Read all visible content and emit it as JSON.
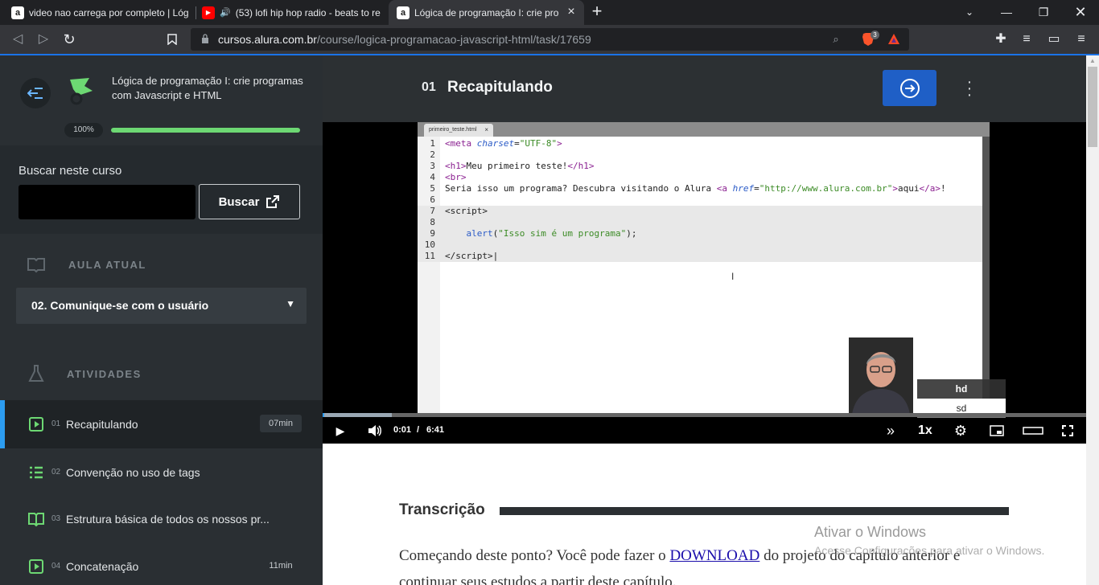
{
  "browser": {
    "tabs": [
      {
        "title": "video nao carrega por completo | Lóg",
        "favicon": "a"
      },
      {
        "title": "(53) lofi hip hop radio - beats to re",
        "favicon": "▶"
      },
      {
        "title": "Lógica de programação I: crie pro",
        "favicon": "a"
      }
    ],
    "url_host": "cursos.alura.com.br",
    "url_path": "/course/logica-programacao-javascript-html/task/17659",
    "brave_badge": "3"
  },
  "sidebar": {
    "course_title": "Lógica de programação I: crie programas com Javascript e HTML",
    "progress_label": "100%",
    "progress_fraction": 1.0,
    "search_label": "Buscar neste curso",
    "search_value": "",
    "search_button": "Buscar",
    "current_section_label": "AULA ATUAL",
    "current_lesson": "02. Comunique-se com o usuário",
    "activities_label": "ATIVIDADES",
    "activities": [
      {
        "num": "01",
        "label": "Recapitulando",
        "duration": "07min",
        "icon": "video-icon"
      },
      {
        "num": "02",
        "label": "Convenção no uso de tags",
        "duration": "",
        "icon": "list-icon"
      },
      {
        "num": "03",
        "label": "Estrutura básica de todos os nossos pr...",
        "duration": "",
        "icon": "book-icon"
      },
      {
        "num": "04",
        "label": "Concatenação",
        "duration": "11min",
        "icon": "video-icon"
      }
    ]
  },
  "main": {
    "task_num": "01",
    "task_title": "Recapitulando"
  },
  "video": {
    "editor_tab": "primeiro_teste.html",
    "code": [
      {
        "n": "1"
      },
      {
        "n": "2"
      },
      {
        "n": "3"
      },
      {
        "n": "4"
      },
      {
        "n": "5"
      },
      {
        "n": "6"
      },
      {
        "n": "7"
      },
      {
        "n": "8"
      },
      {
        "n": "9"
      },
      {
        "n": "10"
      },
      {
        "n": "11"
      }
    ],
    "current_time": "0:01",
    "separator": "/",
    "duration": "6:41",
    "speed": "1x",
    "quality_options": [
      "hd",
      "sd"
    ],
    "played_fraction": 0.002
  },
  "transcript": {
    "heading": "Transcrição",
    "text_before": "Começando deste ponto? Você pode fazer o ",
    "link": "DOWNLOAD",
    "text_after": " do projeto do capítulo anterior e continuar seus estudos a partir deste capítulo."
  },
  "watermark": {
    "line1": "Ativar o Windows",
    "line2": "Acesse Configurações para ativar o Windows."
  }
}
